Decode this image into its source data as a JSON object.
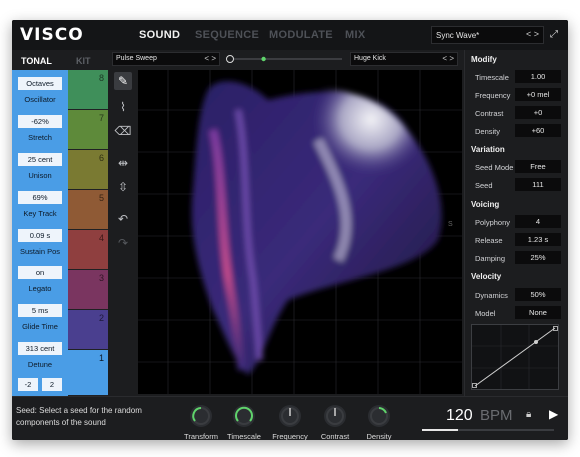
{
  "app": {
    "logo": "VISCO"
  },
  "nav": {
    "tabs": [
      "SOUND",
      "SEQUENCE",
      "MODULATE",
      "MIX"
    ],
    "active": "SOUND"
  },
  "preset": {
    "name": "Sync Wave*",
    "arrows": "< >"
  },
  "left_tabs": {
    "tonal": "TONAL",
    "kit": "KIT"
  },
  "tonal": {
    "octaves": "Octaves",
    "oscillator": "Oscillator",
    "stretch_value": "-62%",
    "stretch_label": "Stretch",
    "unison_value": "25 cent",
    "unison_label": "Unison",
    "keytrack_value": "69%",
    "keytrack_label": "Key Track",
    "sustain_value": "0.09 s",
    "sustain_label": "Sustain Pos",
    "legato_value": "on",
    "legato_label": "Legato",
    "glide_value": "5 ms",
    "glide_label": "Glide Time",
    "detune_value": "313 cent",
    "detune_label": "Detune",
    "range_low": "-2",
    "range_high": "2"
  },
  "kit": {
    "slots": [
      "8",
      "7",
      "6",
      "5",
      "4",
      "3",
      "2",
      "1"
    ]
  },
  "canvas": {
    "left_select": "Pulse Sweep",
    "right_select": "Huge Kick",
    "side_label": "S",
    "blend": 0.3
  },
  "modify": {
    "title": "Modify",
    "timescale_label": "Timescale",
    "timescale_value": "1.00",
    "frequency_label": "Frequency",
    "frequency_value": "+0 mel",
    "contrast_label": "Contrast",
    "contrast_value": "+0",
    "density_label": "Density",
    "density_value": "+60"
  },
  "variation": {
    "title": "Variation",
    "seedmode_label": "Seed Mode",
    "seedmode_value": "Free",
    "seed_label": "Seed",
    "seed_value": "111"
  },
  "voicing": {
    "title": "Voicing",
    "polyphony_label": "Polyphony",
    "polyphony_value": "4",
    "release_label": "Release",
    "release_value": "1.23 s",
    "damping_label": "Damping",
    "damping_value": "25%"
  },
  "velocity": {
    "title": "Velocity",
    "dynamics_label": "Dynamics",
    "dynamics_value": "50%",
    "model_label": "Model",
    "model_value": "None"
  },
  "bottom": {
    "hint": "Seed: Select a seed for the random components of the sound",
    "knobs": [
      "Transform",
      "Timescale",
      "Frequency",
      "Contrast",
      "Density"
    ],
    "bpm_value": "120",
    "bpm_label": "BPM"
  },
  "colors": {
    "accent_blue": "#4a9de6",
    "knob_green": "#5fd36b",
    "kit_colors": [
      "#3f8f5a",
      "#5e8a3a",
      "#7a7a32",
      "#8f5a35",
      "#8f3f3f",
      "#7a3560",
      "#4a3f8f",
      "#2f5fae"
    ]
  }
}
